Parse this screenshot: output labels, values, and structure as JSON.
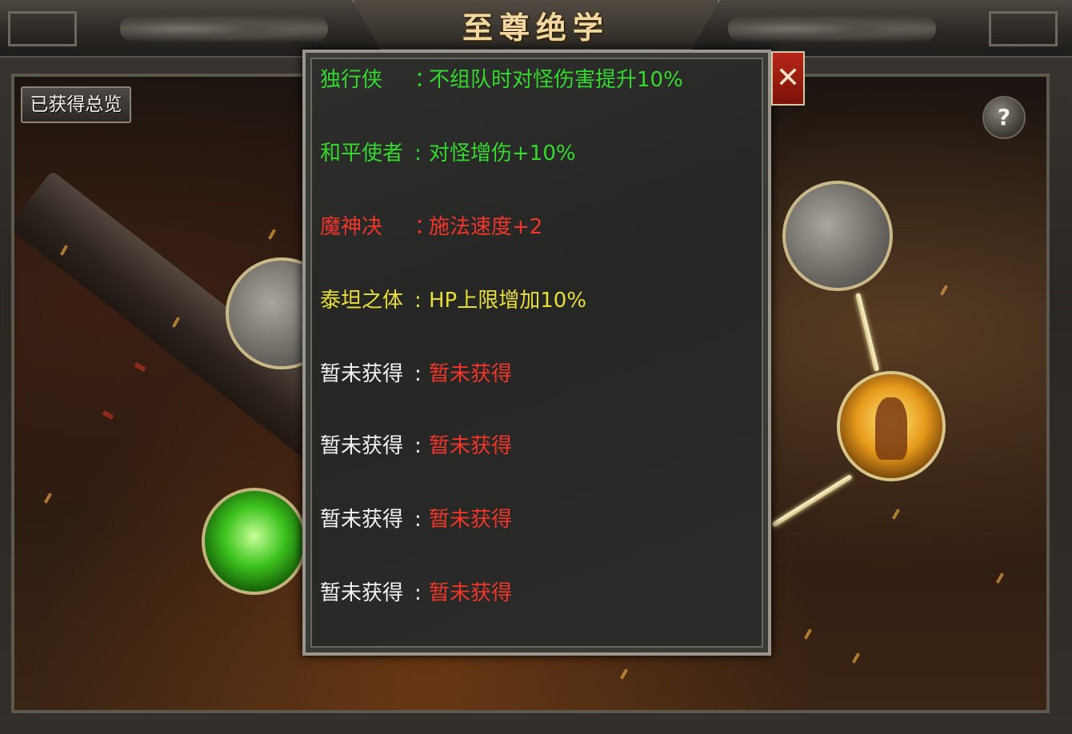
{
  "window": {
    "title": "至尊绝学"
  },
  "overview_button": {
    "label": "已获得总览"
  },
  "help_button": {
    "label": "?"
  },
  "close_button": {
    "label": "✕"
  },
  "colors": {
    "green": "#35d82e",
    "red": "#f0352a",
    "yellow": "#e8de3a",
    "white": "#f2f2f2"
  },
  "skills": [
    {
      "name": "独行侠",
      "colon": "：",
      "effect": "不组队时对怪伤害提升10%",
      "name_color": "#35d82e",
      "effect_color": "#35d82e"
    },
    {
      "name": "和平使者",
      "colon": ":",
      "effect": "对怪增伤+10%",
      "name_color": "#35d82e",
      "effect_color": "#35d82e"
    },
    {
      "name": "魔神决",
      "colon": "：",
      "effect": "施法速度+2",
      "name_color": "#f0352a",
      "effect_color": "#f0352a"
    },
    {
      "name": "泰坦之体",
      "colon": ":",
      "effect": "HP上限增加10%",
      "name_color": "#e8de3a",
      "effect_color": "#e8de3a"
    },
    {
      "name": "暂未获得",
      "colon": ":",
      "effect": "暂未获得",
      "name_color": "#f2f2f2",
      "effect_color": "#f0352a"
    },
    {
      "name": "暂未获得",
      "colon": ":",
      "effect": "暂未获得",
      "name_color": "#f2f2f2",
      "effect_color": "#f0352a"
    },
    {
      "name": "暂未获得",
      "colon": ":",
      "effect": "暂未获得",
      "name_color": "#f2f2f2",
      "effect_color": "#f0352a"
    },
    {
      "name": "暂未获得",
      "colon": ":",
      "effect": "暂未获得",
      "name_color": "#f2f2f2",
      "effect_color": "#f0352a"
    }
  ]
}
